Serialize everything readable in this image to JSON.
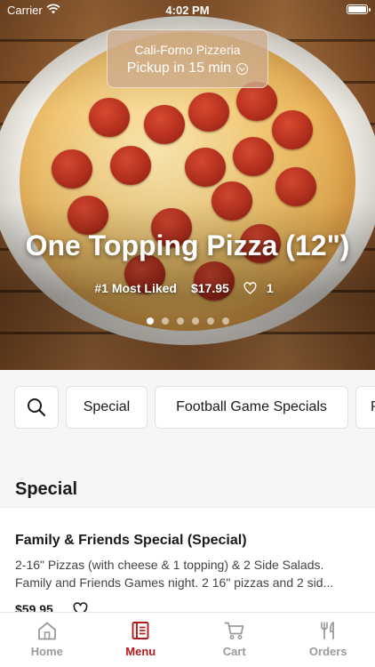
{
  "status_bar": {
    "carrier": "Carrier",
    "time": "4:02 PM"
  },
  "store": {
    "name": "Cali-Forno Pizzeria",
    "pickup": "Pickup in 15 min"
  },
  "featured": {
    "title": "One Topping Pizza (12\")",
    "rank": "#1 Most Liked",
    "price": "$17.95",
    "likes": "1",
    "carousel_count": 6,
    "carousel_active_index": 0
  },
  "categories": {
    "chips": [
      "Special",
      "Football Game Specials",
      "P"
    ]
  },
  "section": {
    "title": "Special",
    "items": [
      {
        "name": "Family & Friends Special (Special)",
        "description_line1": "2-16\" Pizzas (with cheese & 1 topping) & 2 Side Salads.",
        "description_line2": "Family and Friends Games night. 2 16\" pizzas and 2 sid...",
        "price": "$59.95"
      }
    ]
  },
  "tabs": [
    {
      "label": "Home",
      "icon": "home-icon"
    },
    {
      "label": "Menu",
      "icon": "menu-icon",
      "active": true
    },
    {
      "label": "Cart",
      "icon": "cart-icon"
    },
    {
      "label": "Orders",
      "icon": "orders-icon"
    }
  ],
  "colors": {
    "accent": "#b31b1b",
    "inactive_tab": "#9a9a9a",
    "background": "#f6f6f6"
  }
}
